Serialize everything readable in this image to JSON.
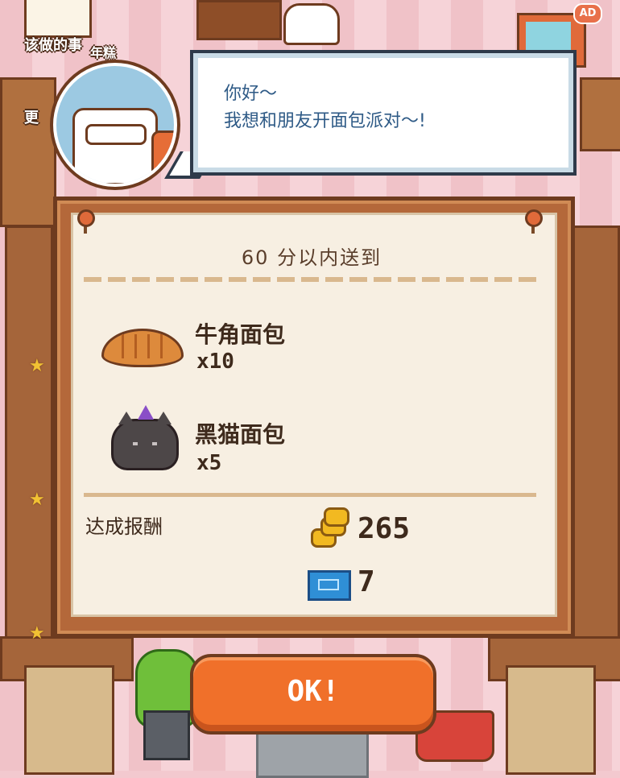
{
  "hud": {
    "top_left_label": "该做的事",
    "top_left_sub": "年糕",
    "left_label": "更",
    "ad_badge": "AD"
  },
  "dialog": {
    "message": "你好～\n我想和朋友开面包派对～!"
  },
  "order": {
    "time_limit_text": "60 分以内送到",
    "items": [
      {
        "name": "牛角面包",
        "quantity": "x10",
        "icon": "croissant-icon"
      },
      {
        "name": "黑猫面包",
        "quantity": "x5",
        "icon": "black-cat-bread-icon"
      }
    ],
    "reward_label": "达成报酬",
    "rewards": [
      {
        "icon": "gold-coins-icon",
        "value": "265"
      },
      {
        "icon": "ticket-icon",
        "value": "7"
      }
    ]
  },
  "ok_button": {
    "label": "OK!"
  },
  "colors": {
    "frame": "#b4683a",
    "card": "#f7efe2",
    "ok_button": "#f0702a",
    "bubble_text": "#2e5a86",
    "background": "#f3c9cf"
  }
}
